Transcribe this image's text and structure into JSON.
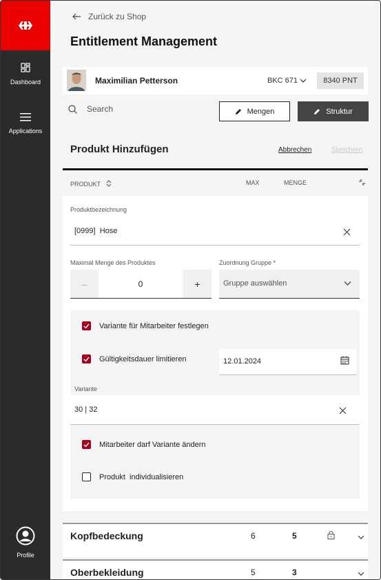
{
  "sidebar": {
    "items": [
      {
        "label": "Dashboard",
        "icon": "dashboard-icon"
      },
      {
        "label": "Applications",
        "icon": "menu-icon"
      }
    ],
    "profile": {
      "label": "Profile",
      "icon": "profile-icon"
    },
    "logo_color": "#eb0000"
  },
  "header": {
    "back_label": "Zurück zu Shop",
    "title": "Entitlement Management"
  },
  "user": {
    "name": "Maximilian Petterson",
    "code": "BKC 671",
    "points": "8340 PNT"
  },
  "toolbar": {
    "search_placeholder": "Search",
    "mengen_label": "Mengen",
    "struktur_label": "Struktur"
  },
  "section": {
    "title": "Produkt Hinzufügen",
    "cancel_label": "Abbrechen",
    "save_label": "Speichern"
  },
  "table_header": {
    "produkt": "PRODUKT",
    "max": "MAX",
    "menge": "MENGE"
  },
  "form": {
    "produkt_label": "Produktbezeichnung",
    "produkt_value": "[0999]  Hose",
    "max_menge_label": "Maximal Menge des Produktes",
    "max_menge_value": "0",
    "gruppe_label": "Zuordnung Gruppe *",
    "gruppe_placeholder": "Gruppe auswählen",
    "options": {
      "variante_festlegen": "Variante für Mitarbeiter festlegen",
      "gueltigkeit": "Gültigkeitsdauer limitieren",
      "mitarbeiter_aendern": "Mitarbeiter darf Variante ändern",
      "individualisieren": "Produkt  individualisieren"
    },
    "date_value": "12.01.2024",
    "variante_label": "Variante",
    "variante_value": "30 | 32"
  },
  "groups": [
    {
      "name": "Kopfbedeckung",
      "max": "6",
      "menge": "5"
    },
    {
      "name": "Oberbekleidung",
      "max": "5",
      "menge": "3"
    }
  ],
  "colors": {
    "accent": "#eb0000",
    "checkbox": "#a5001d",
    "sidebar": "#2b2b2b"
  }
}
